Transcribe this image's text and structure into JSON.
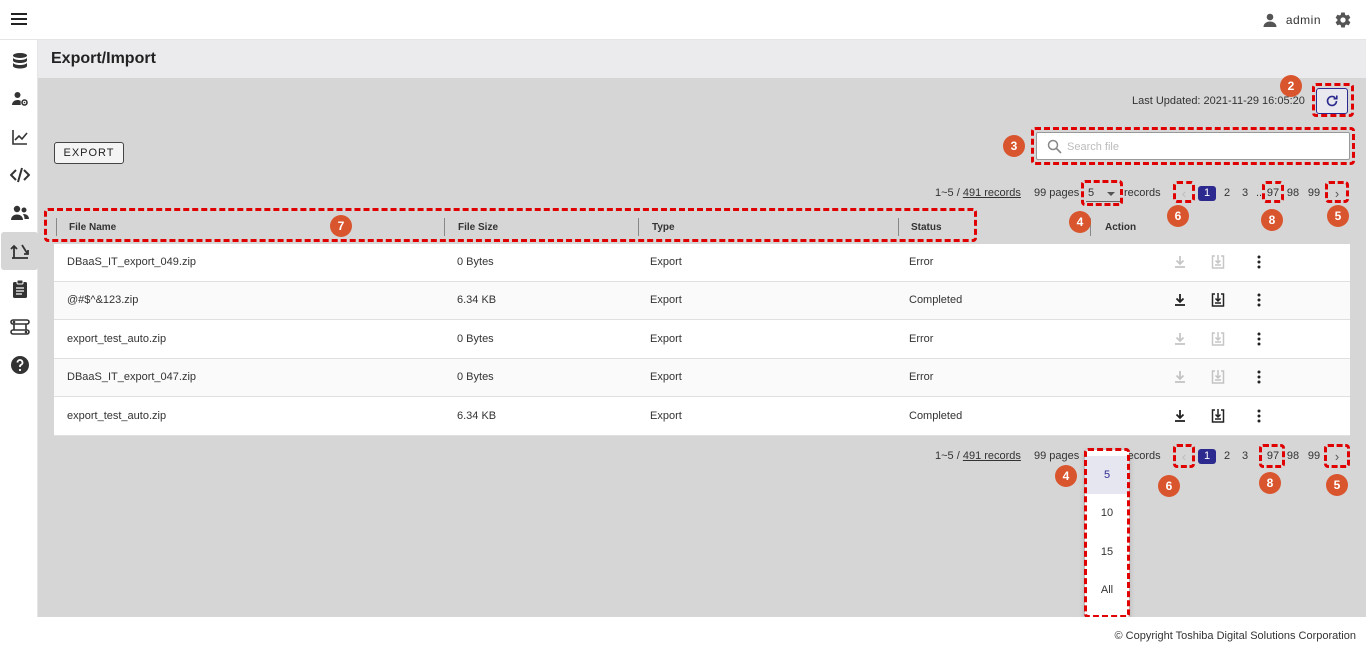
{
  "topbar": {
    "user": "admin"
  },
  "page": {
    "title": "Export/Import"
  },
  "toolbar": {
    "last_updated": "Last Updated: 2021-11-29 16:05:20",
    "export_label": "EXPORT",
    "search_placeholder": "Search file"
  },
  "pagination": {
    "range_prefix": "1~5 / ",
    "total_records": "491 records",
    "pages_label": "99 pages",
    "per_page": "5",
    "records_label": "records",
    "prev": "‹",
    "next": "›",
    "pages": [
      "1",
      "2",
      "3",
      "..",
      "97",
      "98",
      "99"
    ],
    "current_page": "1"
  },
  "table": {
    "headers": {
      "file_name": "File Name",
      "file_size": "File Size",
      "type": "Type",
      "status": "Status",
      "action": "Action"
    },
    "rows": [
      {
        "file_name": "DBaaS_IT_export_049.zip",
        "file_size": "0 Bytes",
        "type": "Export",
        "status": "Error",
        "enabled": false
      },
      {
        "file_name": "@#$^&123.zip",
        "file_size": "6.34 KB",
        "type": "Export",
        "status": "Completed",
        "enabled": true
      },
      {
        "file_name": "export_test_auto.zip",
        "file_size": "0 Bytes",
        "type": "Export",
        "status": "Error",
        "enabled": false
      },
      {
        "file_name": "DBaaS_IT_export_047.zip",
        "file_size": "0 Bytes",
        "type": "Export",
        "status": "Error",
        "enabled": false
      },
      {
        "file_name": "export_test_auto.zip",
        "file_size": "6.34 KB",
        "type": "Export",
        "status": "Completed",
        "enabled": true
      }
    ]
  },
  "per_page_options": [
    "5",
    "10",
    "15",
    "All"
  ],
  "annotations": [
    "2",
    "3",
    "4",
    "5",
    "6",
    "7",
    "8",
    "4",
    "6",
    "8",
    "5"
  ],
  "footer": {
    "copyright": "© Copyright Toshiba Digital Solutions Corporation"
  },
  "sidebar": {
    "icons": [
      "database-icon",
      "user-settings-icon",
      "chart-icon",
      "code-icon",
      "users-icon",
      "export-import-icon",
      "clipboard-icon",
      "workflow-icon",
      "help-icon"
    ],
    "active": "export-import-icon"
  },
  "colors": {
    "accent": "#2d2a8f",
    "annotation": "#e00000",
    "badge": "#d9552e",
    "content_bg": "#d6d6d6"
  }
}
